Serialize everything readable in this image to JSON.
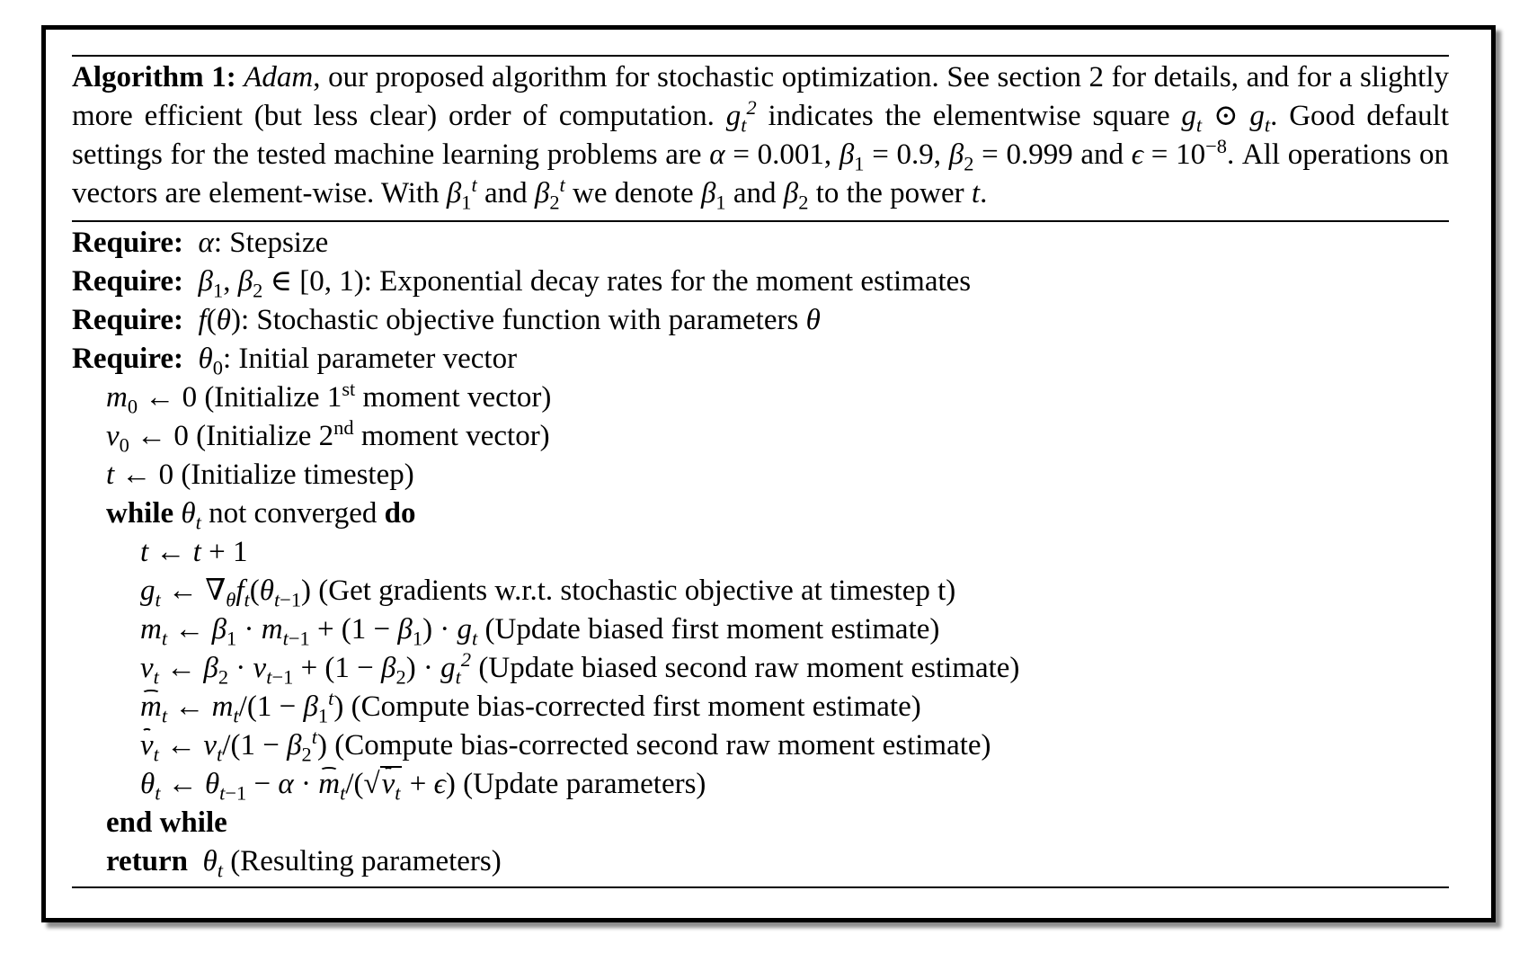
{
  "caption": {
    "label": "Algorithm 1:",
    "name": "Adam",
    "text1": ", our proposed algorithm for stochastic optimization. See section 2 for details, and for a slightly more efficient (but less clear) order of computation. ",
    "text2": " indicates the elementwise square ",
    "text3": ". Good default settings for the tested machine learning problems are ",
    "defaults": "α = 0.001, β₁ = 0.9, β₂ = 0.999 and ϵ = 10⁻⁸",
    "text4": ". All operations on vectors are element-wise. With ",
    "text5": " we denote ",
    "text6": " to the power "
  },
  "requires": [
    {
      "keyword": "Require:",
      "symbol": "α",
      "desc": ": Stepsize"
    },
    {
      "keyword": "Require:",
      "symbol": "β₁, β₂ ∈ [0, 1)",
      "desc": ": Exponential decay rates for the moment estimates"
    },
    {
      "keyword": "Require:",
      "symbol": "f(θ)",
      "desc": ": Stochastic objective function with parameters θ"
    },
    {
      "keyword": "Require:",
      "symbol": "θ₀",
      "desc": ": Initial parameter vector"
    }
  ],
  "init": [
    {
      "expr": "m₀ ← 0",
      "note_pre": " (Initialize 1",
      "sup": "st",
      "note_post": " moment vector)"
    },
    {
      "expr": "v₀ ← 0",
      "note_pre": " (Initialize 2",
      "sup": "nd",
      "note_post": " moment vector)"
    },
    {
      "expr": "t ← 0",
      "note": " (Initialize timestep)"
    }
  ],
  "loop": {
    "while_kw": "while",
    "while_cond": " not converged ",
    "do_kw": "do",
    "steps": [
      {
        "note": ""
      },
      {
        "note": " (Get gradients w.r.t. stochastic objective at timestep t)"
      },
      {
        "note": " (Update biased first moment estimate)"
      },
      {
        "note": " (Update biased second raw moment estimate)"
      },
      {
        "note": " (Compute bias-corrected first moment estimate)"
      },
      {
        "note": " (Compute bias-corrected second raw moment estimate)"
      },
      {
        "note": " (Update parameters)"
      }
    ],
    "end_kw": "end while"
  },
  "return": {
    "keyword": "return",
    "note": " (Resulting parameters)"
  }
}
